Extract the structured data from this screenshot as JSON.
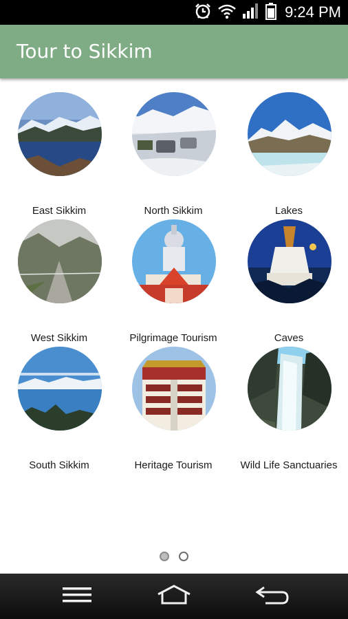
{
  "status_bar": {
    "time": "9:24 PM",
    "icons": [
      "alarm-icon",
      "wifi-icon",
      "signal-icon",
      "battery-icon"
    ]
  },
  "app_bar": {
    "title": "Tour to Sikkim",
    "color": "#7fac84"
  },
  "categories": [
    {
      "label": "East Sikkim",
      "image": "lake-valley-photo"
    },
    {
      "label": "North Sikkim",
      "image": "snow-road-vehicles-photo"
    },
    {
      "label": "Lakes",
      "image": "frozen-lake-mountains-photo"
    },
    {
      "label": "West Sikkim",
      "image": "mountain-valley-photo"
    },
    {
      "label": "Pilgrimage Tourism",
      "image": "shiva-statue-temple-photo"
    },
    {
      "label": "Caves",
      "image": "stupa-night-photo"
    },
    {
      "label": "South Sikkim",
      "image": "kanchenjunga-sky-photo"
    },
    {
      "label": "Heritage Tourism",
      "image": "monastery-facade-photo"
    },
    {
      "label": "Wild Life Sanctuaries",
      "image": "waterfall-photo"
    }
  ],
  "pager": {
    "pages": 2,
    "current_page": 1
  },
  "nav_bar": {
    "buttons": [
      "menu-icon",
      "home-icon",
      "back-icon"
    ]
  }
}
